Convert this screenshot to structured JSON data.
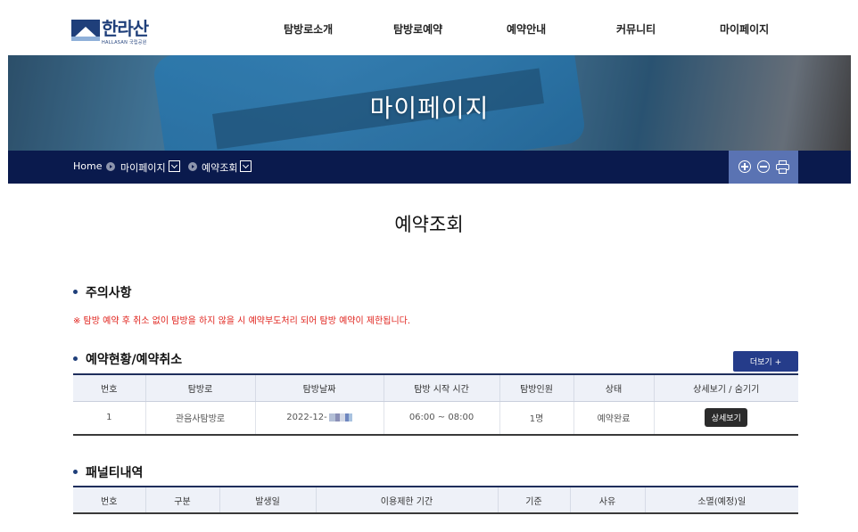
{
  "header": {
    "logo_text": "한라산",
    "logo_sub": "HALLASAN 국립공원",
    "nav": [
      "탐방로소개",
      "탐방로예약",
      "예약안내",
      "커뮤니티",
      "마이페이지"
    ]
  },
  "banner": {
    "title": "마이페이지"
  },
  "breadcrumb": {
    "home": "Home",
    "level1": "마이페이지",
    "level2": "예약조회"
  },
  "page": {
    "title": "예약조회"
  },
  "notice": {
    "heading": "주의사항",
    "text": "※ 탐방 예약 후 취소 없이 탐방을 하지 않을 시 예약부도처리 되어 탐방 예약이 제한됩니다."
  },
  "reservations": {
    "heading": "예약현황/예약취소",
    "more_label": "더보기 +",
    "columns": [
      "번호",
      "탐방로",
      "탐방날짜",
      "탐방 시작 시간",
      "탐방인원",
      "상태",
      "상세보기 / 숨기기"
    ],
    "rows": [
      {
        "no": "1",
        "trail": "관음사탐방로",
        "date": "2022-12-",
        "time": "06:00 ~ 08:00",
        "people": "1명",
        "status": "예약완료",
        "action": "상세보기"
      }
    ]
  },
  "penalty": {
    "heading": "패널티내역",
    "columns": [
      "번호",
      "구분",
      "발생일",
      "이용제한 기간",
      "기준",
      "사유",
      "소멸(예정)일"
    ]
  },
  "colors": {
    "navy": "#0a1a4d",
    "accent_blue": "#253c8a",
    "notice_red": "#e0231d"
  }
}
